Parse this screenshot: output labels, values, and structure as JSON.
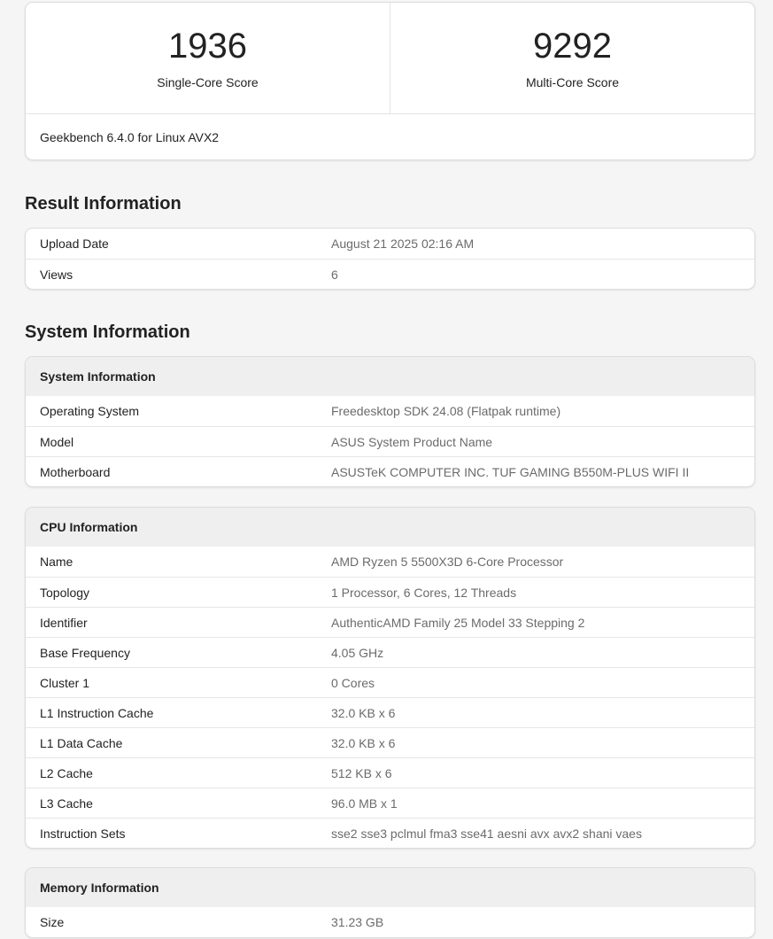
{
  "scores": {
    "single": {
      "value": "1936",
      "label": "Single-Core Score"
    },
    "multi": {
      "value": "9292",
      "label": "Multi-Core Score"
    },
    "version": "Geekbench 6.4.0 for Linux AVX2"
  },
  "result_info": {
    "title": "Result Information",
    "rows": [
      {
        "key": "Upload Date",
        "value": "August 21 2025 02:16 AM"
      },
      {
        "key": "Views",
        "value": "6"
      }
    ]
  },
  "system_section_title": "System Information",
  "system_info": {
    "header": "System Information",
    "rows": [
      {
        "key": "Operating System",
        "value": "Freedesktop SDK 24.08 (Flatpak runtime)"
      },
      {
        "key": "Model",
        "value": "ASUS System Product Name"
      },
      {
        "key": "Motherboard",
        "value": "ASUSTeK COMPUTER INC. TUF GAMING B550M-PLUS WIFI II"
      }
    ]
  },
  "cpu_info": {
    "header": "CPU Information",
    "rows": [
      {
        "key": "Name",
        "value": "AMD Ryzen 5 5500X3D 6-Core Processor"
      },
      {
        "key": "Topology",
        "value": "1 Processor, 6 Cores, 12 Threads"
      },
      {
        "key": "Identifier",
        "value": "AuthenticAMD Family 25 Model 33 Stepping 2"
      },
      {
        "key": "Base Frequency",
        "value": "4.05 GHz"
      },
      {
        "key": "Cluster 1",
        "value": "0 Cores"
      },
      {
        "key": "L1 Instruction Cache",
        "value": "32.0 KB x 6"
      },
      {
        "key": "L1 Data Cache",
        "value": "32.0 KB x 6"
      },
      {
        "key": "L2 Cache",
        "value": "512 KB x 6"
      },
      {
        "key": "L3 Cache",
        "value": "96.0 MB x 1"
      },
      {
        "key": "Instruction Sets",
        "value": "sse2 sse3 pclmul fma3 sse41 aesni avx avx2 shani vaes"
      }
    ]
  },
  "memory_info": {
    "header": "Memory Information",
    "rows": [
      {
        "key": "Size",
        "value": "31.23 GB"
      }
    ]
  }
}
